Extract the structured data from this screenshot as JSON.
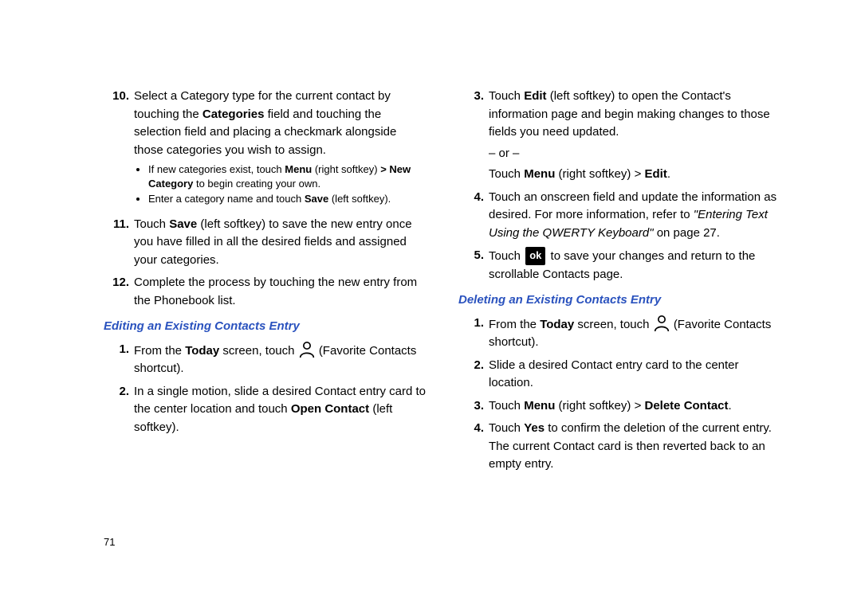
{
  "pageNumber": "71",
  "left": {
    "item10": {
      "num": "10.",
      "text_a": "Select a Category type for the current contact by touching the ",
      "bold1": "Categories",
      "text_b": " field and touching the selection field and placing a checkmark alongside those categories you wish to assign.",
      "bullet1_a": "If new categories exist, touch ",
      "bullet1_b": "Menu",
      "bullet1_c": " (right softkey) ",
      "bullet1_d": "> New Category",
      "bullet1_e": " to begin creating your own.",
      "bullet2_a": "Enter a category name and touch ",
      "bullet2_b": "Save",
      "bullet2_c": " (left softkey)."
    },
    "item11": {
      "num": "11.",
      "text_a": "Touch ",
      "bold1": "Save",
      "text_b": " (left softkey) to save the new entry once you have filled in all the desired fields and assigned your categories."
    },
    "item12": {
      "num": "12.",
      "text": "Complete the process by touching the new entry from the Phonebook list."
    },
    "heading": "Editing an Existing Contacts Entry",
    "edit1": {
      "num": "1.",
      "text_a": "From the ",
      "bold1": "Today",
      "text_b": " screen, touch ",
      "text_c": " (Favorite Contacts shortcut)."
    },
    "edit2": {
      "num": "2.",
      "text_a": "In a single motion, slide a desired Contact entry card to the center location and touch ",
      "bold1": "Open Contact",
      "text_b": " (left softkey)."
    }
  },
  "right": {
    "item3": {
      "num": "3.",
      "text_a": "Touch ",
      "bold1": "Edit",
      "text_b": " (left softkey) to open the Contact's information page and begin making changes to those fields you need updated.",
      "or": "– or –",
      "line2_a": "Touch ",
      "line2_b": "Menu",
      "line2_c": " (right softkey) > ",
      "line2_d": "Edit",
      "line2_e": "."
    },
    "item4": {
      "num": "4.",
      "text_a": "Touch an onscreen field and update the information as desired. For more information, refer to ",
      "italic1": "\"Entering Text Using the QWERTY Keyboard\"",
      "text_b": "  on page 27."
    },
    "item5": {
      "num": "5.",
      "text_a": "Touch ",
      "ok": "ok",
      "text_b": " to save your changes and return to the scrollable Contacts page."
    },
    "heading": "Deleting an Existing Contacts Entry",
    "del1": {
      "num": "1.",
      "text_a": "From the ",
      "bold1": "Today",
      "text_b": " screen, touch ",
      "text_c": " (Favorite Contacts shortcut)."
    },
    "del2": {
      "num": "2.",
      "text": "Slide a desired Contact entry card to the center location."
    },
    "del3": {
      "num": "3.",
      "text_a": "Touch ",
      "bold1": "Menu",
      "text_b": " (right softkey) > ",
      "bold2": "Delete Contact",
      "text_c": "."
    },
    "del4": {
      "num": "4.",
      "text_a": "Touch ",
      "bold1": "Yes",
      "text_b": " to confirm the deletion of the current entry. The current Contact card is then reverted back to an empty entry."
    }
  }
}
